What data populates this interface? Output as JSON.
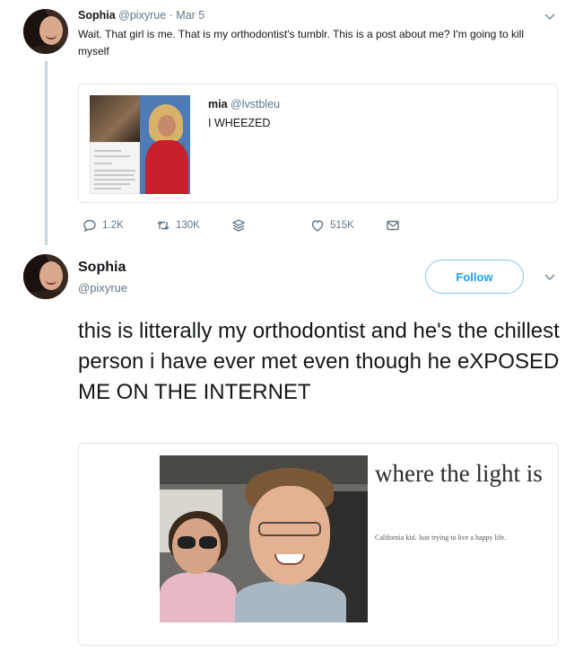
{
  "tweet1": {
    "name": "Sophia",
    "handle": "@pixyrue",
    "separator": "·",
    "date": "Mar 5",
    "text": "Wait. That girl is me. That is my orthodontist's tumblr. This is a post about me? I'm going to kill myself",
    "quote": {
      "name": "mia",
      "handle": "@lvstbleu",
      "text": "I WHEEZED"
    },
    "actions": {
      "replies": "1.2K",
      "retweets": "130K",
      "likes": "515K"
    }
  },
  "tweet2": {
    "name": "Sophia",
    "handle": "@pixyrue",
    "follow_label": "Follow",
    "text": "this is litterally my orthodontist and he's the chillest person i have ever met even though he eXPOSED ME ON THE INTERNET",
    "card": {
      "title": "where the light is",
      "subtitle": "California kid. Just trying to live a happy life."
    }
  },
  "colors": {
    "accent": "#1da1f2",
    "muted": "#657786",
    "border": "#e1e8ed"
  }
}
